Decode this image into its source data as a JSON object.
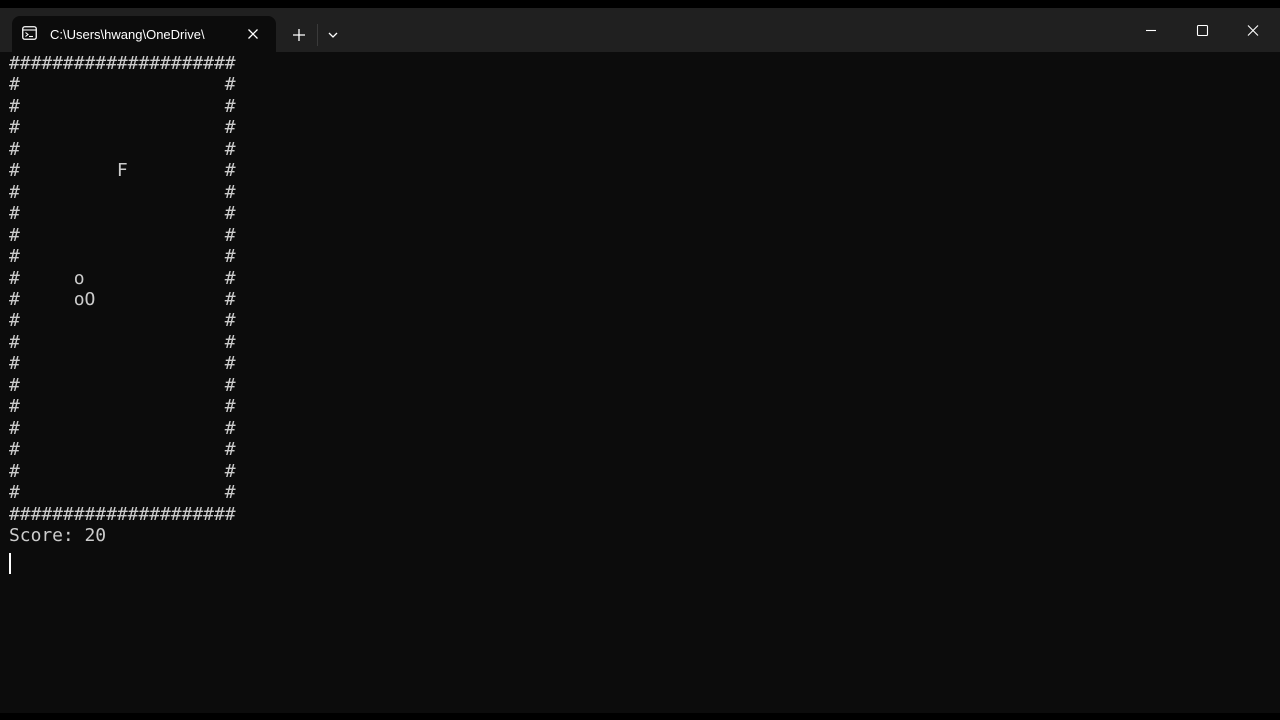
{
  "window": {
    "tab_title": "C:\\Users\\hwang\\OneDrive\\",
    "tab_icon": "terminal-icon",
    "close_tab_icon": "close-icon",
    "new_tab_icon": "plus-icon",
    "dropdown_icon": "chevron-down-icon",
    "minimize_icon": "minimize-icon",
    "maximize_icon": "maximize-icon",
    "close_window_icon": "close-icon"
  },
  "console": {
    "board_rows": [
      "#####################",
      "#                   #",
      "#                   #",
      "#                   #",
      "#                   #",
      "#         F         #",
      "#                   #",
      "#                   #",
      "#                   #",
      "#                   #",
      "#     o             #",
      "#     oO            #",
      "#                   #",
      "#                   #",
      "#                   #",
      "#                   #",
      "#                   #",
      "#                   #",
      "#                   #",
      "#                   #",
      "#                   #",
      "#####################"
    ],
    "score_line": "Score: 20"
  },
  "colors": {
    "background": "#0c0c0c",
    "titlebar": "#202020",
    "text": "#cccccc"
  }
}
